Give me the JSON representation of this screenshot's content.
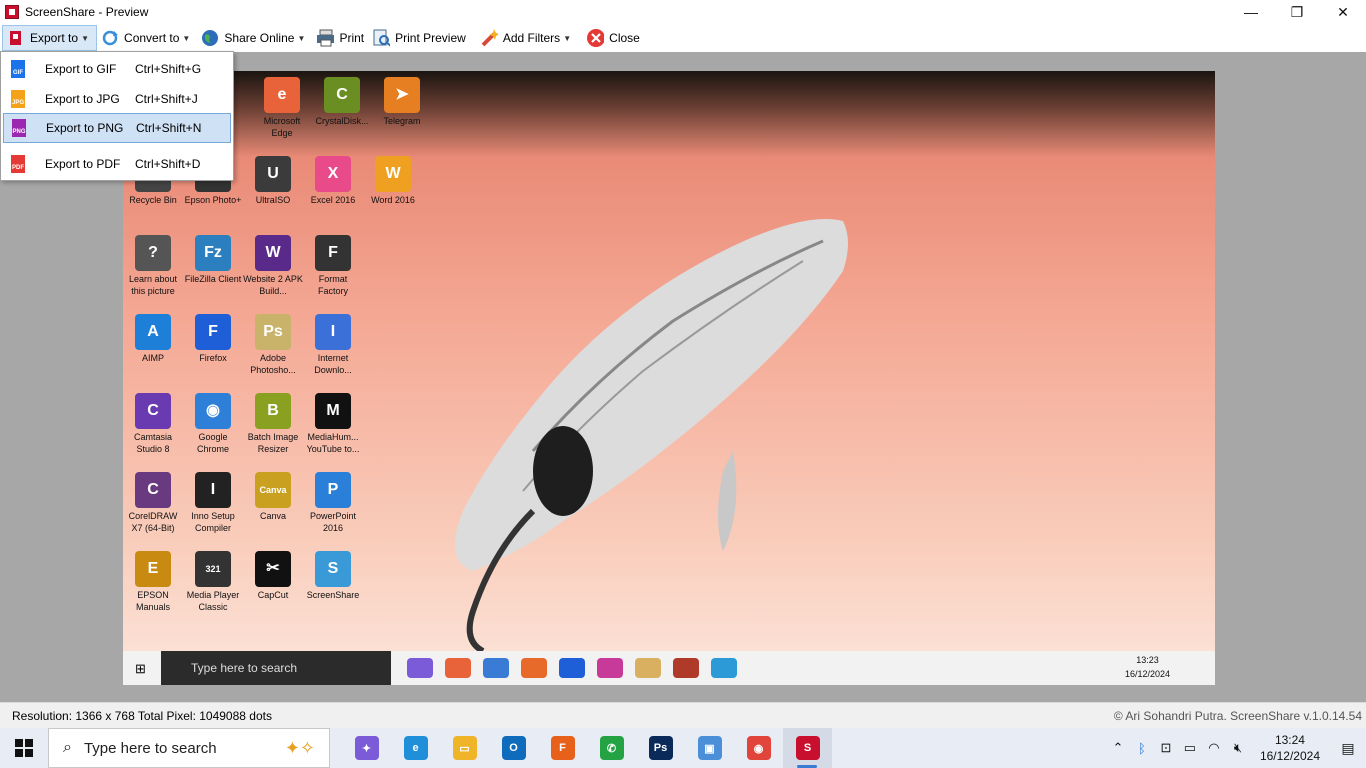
{
  "window": {
    "title": "ScreenShare - Preview",
    "controls": {
      "minimize": "—",
      "maximize": "❐",
      "close": "✕"
    }
  },
  "toolbar": {
    "export_label": "Export to",
    "convert_label": "Convert to",
    "share_label": "Share Online",
    "print_label": "Print",
    "print_preview_label": "Print Preview",
    "filters_label": "Add Filters",
    "close_label": "Close"
  },
  "export_menu": {
    "items": [
      {
        "label": "Export to GIF",
        "shortcut": "Ctrl+Shift+G",
        "badge": "GIF",
        "color": "#1a73e8"
      },
      {
        "label": "Export to JPG",
        "shortcut": "Ctrl+Shift+J",
        "badge": "JPG",
        "color": "#f4a21a"
      },
      {
        "label": "Export to PNG",
        "shortcut": "Ctrl+Shift+N",
        "badge": "PNG",
        "color": "#9c27b0"
      },
      {
        "label": "Export to PDF",
        "shortcut": "Ctrl+Shift+D",
        "badge": "PDF",
        "color": "#e53935"
      }
    ]
  },
  "desktop_icons": [
    {
      "label": "Microsoft Edge",
      "glyph": "e",
      "color": "#e8633a"
    },
    {
      "label": "CrystalDisk...",
      "glyph": "C",
      "color": "#6b8e23"
    },
    {
      "label": "Telegram",
      "glyph": "➤",
      "color": "#e67e22"
    },
    {
      "label": "Recycle Bin",
      "glyph": "♻",
      "color": "#444444"
    },
    {
      "label": "Epson Photo+",
      "glyph": "E",
      "color": "#333333"
    },
    {
      "label": "UltraISO",
      "glyph": "U",
      "color": "#3b3b3b"
    },
    {
      "label": "Excel 2016",
      "glyph": "X",
      "color": "#e84a8a"
    },
    {
      "label": "Word 2016",
      "glyph": "W",
      "color": "#f0a020"
    },
    {
      "label": "Learn about this picture",
      "glyph": "?",
      "color": "#555555"
    },
    {
      "label": "FileZilla Client",
      "glyph": "Fz",
      "color": "#2c7fbf"
    },
    {
      "label": "Website 2 APK Build...",
      "glyph": "W",
      "color": "#5a2a8a"
    },
    {
      "label": "Format Factory",
      "glyph": "F",
      "color": "#333333"
    },
    {
      "label": "AIMP",
      "glyph": "A",
      "color": "#1e7fd8"
    },
    {
      "label": "Firefox",
      "glyph": "F",
      "color": "#1e5fd8"
    },
    {
      "label": "Adobe Photosho...",
      "glyph": "Ps",
      "color": "#c9b36a"
    },
    {
      "label": "Internet Downlo...",
      "glyph": "I",
      "color": "#3a70d8"
    },
    {
      "label": "Camtasia Studio 8",
      "glyph": "C",
      "color": "#6a3ab0"
    },
    {
      "label": "Google Chrome",
      "glyph": "◉",
      "color": "#2d7fd8"
    },
    {
      "label": "Batch Image Resizer",
      "glyph": "B",
      "color": "#8aa020"
    },
    {
      "label": "MediaHum... YouTube to...",
      "glyph": "M",
      "color": "#111111"
    },
    {
      "label": "CorelDRAW X7 (64-Bit)",
      "glyph": "C",
      "color": "#6a3a80"
    },
    {
      "label": "Inno Setup Compiler",
      "glyph": "I",
      "color": "#222222"
    },
    {
      "label": "Canva",
      "glyph": "Canva",
      "color": "#c9a020"
    },
    {
      "label": "PowerPoint 2016",
      "glyph": "P",
      "color": "#2a7fd8"
    },
    {
      "label": "EPSON Manuals",
      "glyph": "E",
      "color": "#c88a10"
    },
    {
      "label": "Media Player Classic",
      "glyph": "321",
      "color": "#333333"
    },
    {
      "label": "CapCut",
      "glyph": "✂",
      "color": "#111111"
    },
    {
      "label": "ScreenShare",
      "glyph": "S",
      "color": "#3a9ad8"
    }
  ],
  "mini_taskbar": {
    "search_placeholder": "Type here to search",
    "time": "13:23",
    "date": "16/12/2024"
  },
  "statusbar": {
    "info": "Resolution: 1366 x 768   Total Pixel: 1049088 dots",
    "credit": "© Ari Sohandri Putra.  ScreenShare v.1.0.14.54"
  },
  "taskbar": {
    "search_placeholder": "Type here to search",
    "apps": [
      {
        "name": "copilot",
        "glyph": "✦",
        "color": "#7b5bd8"
      },
      {
        "name": "edge",
        "glyph": "e",
        "color": "#1e8fd8"
      },
      {
        "name": "file-explorer",
        "glyph": "▭",
        "color": "#f0b429"
      },
      {
        "name": "outlook",
        "glyph": "O",
        "color": "#0f6cbd"
      },
      {
        "name": "firefox",
        "glyph": "F",
        "color": "#e8611a"
      },
      {
        "name": "whatsapp",
        "glyph": "✆",
        "color": "#25a244"
      },
      {
        "name": "photoshop",
        "glyph": "Ps",
        "color": "#0a2a5a"
      },
      {
        "name": "network-app",
        "glyph": "▣",
        "color": "#4a8fd8"
      },
      {
        "name": "chrome",
        "glyph": "◉",
        "color": "#e0443a"
      },
      {
        "name": "screenshare",
        "glyph": "S",
        "color": "#c8102e"
      }
    ],
    "time": "13:24",
    "date": "16/12/2024"
  }
}
